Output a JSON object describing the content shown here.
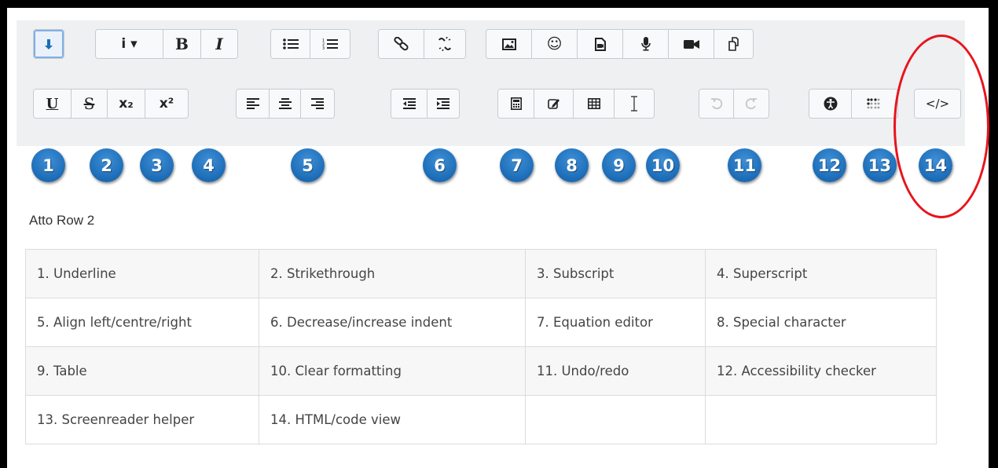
{
  "toolbar": {
    "row1": [
      {
        "group": "collapse",
        "buttons": [
          {
            "icon": "collapse-toggle-icon",
            "active": true
          }
        ]
      },
      {
        "group": "style",
        "buttons": [
          {
            "icon": "paragraph-style-dropdown-icon",
            "label": "i ▾"
          },
          {
            "icon": "bold-icon",
            "label": "B"
          },
          {
            "icon": "italic-icon",
            "label": "I"
          }
        ]
      },
      {
        "group": "list",
        "buttons": [
          {
            "icon": "unordered-list-icon"
          },
          {
            "icon": "ordered-list-icon"
          }
        ]
      },
      {
        "group": "links",
        "buttons": [
          {
            "icon": "link-icon"
          },
          {
            "icon": "unlink-icon"
          }
        ]
      },
      {
        "group": "files",
        "buttons": [
          {
            "icon": "image-icon"
          },
          {
            "icon": "emoticon-icon"
          },
          {
            "icon": "media-icon"
          },
          {
            "icon": "microphone-icon"
          },
          {
            "icon": "video-camera-icon"
          },
          {
            "icon": "manage-files-icon"
          }
        ]
      }
    ],
    "row2": [
      {
        "group": "style2",
        "buttons": [
          {
            "icon": "underline-icon",
            "label": "U"
          },
          {
            "icon": "strikethrough-icon",
            "label": "S"
          },
          {
            "icon": "subscript-icon",
            "label": "x₂"
          },
          {
            "icon": "superscript-icon",
            "label": "x²"
          }
        ]
      },
      {
        "group": "align",
        "buttons": [
          {
            "icon": "align-left-icon"
          },
          {
            "icon": "align-center-icon"
          },
          {
            "icon": "align-right-icon"
          }
        ]
      },
      {
        "group": "indent",
        "buttons": [
          {
            "icon": "outdent-icon"
          },
          {
            "icon": "indent-icon"
          }
        ]
      },
      {
        "group": "insert",
        "buttons": [
          {
            "icon": "equation-icon"
          },
          {
            "icon": "special-character-icon"
          },
          {
            "icon": "table-icon"
          },
          {
            "icon": "clear-formatting-icon"
          }
        ]
      },
      {
        "group": "undo",
        "buttons": [
          {
            "icon": "undo-icon",
            "disabled": true
          },
          {
            "icon": "redo-icon",
            "disabled": true
          }
        ]
      },
      {
        "group": "accessibility",
        "buttons": [
          {
            "icon": "accessibility-checker-icon"
          },
          {
            "icon": "screenreader-helper-icon"
          }
        ]
      },
      {
        "group": "html",
        "buttons": [
          {
            "icon": "html-code-icon",
            "label": "</>"
          }
        ]
      }
    ]
  },
  "badges": [
    "1",
    "2",
    "3",
    "4",
    "5",
    "6",
    "7",
    "8",
    "9",
    "10",
    "11",
    "12",
    "13",
    "14"
  ],
  "section_title": "Atto Row 2",
  "legend": {
    "rows": [
      [
        "1. Underline",
        "2. Strikethrough",
        "3. Subscript",
        "4. Superscript"
      ],
      [
        "5. Align left/centre/right",
        "6. Decrease/increase indent",
        "7. Equation editor",
        "8. Special character"
      ],
      [
        "9. Table",
        "10. Clear formatting",
        "11. Undo/redo",
        "12. Accessibility checker"
      ],
      [
        "13. Screenreader helper",
        "14. HTML/code view",
        "",
        ""
      ]
    ]
  },
  "colors": {
    "badge": "#1e6eb9",
    "annotation_circle": "#e8141c",
    "active_button_border": "#7fb0e3",
    "toolbar_background": "#eef0f2"
  }
}
